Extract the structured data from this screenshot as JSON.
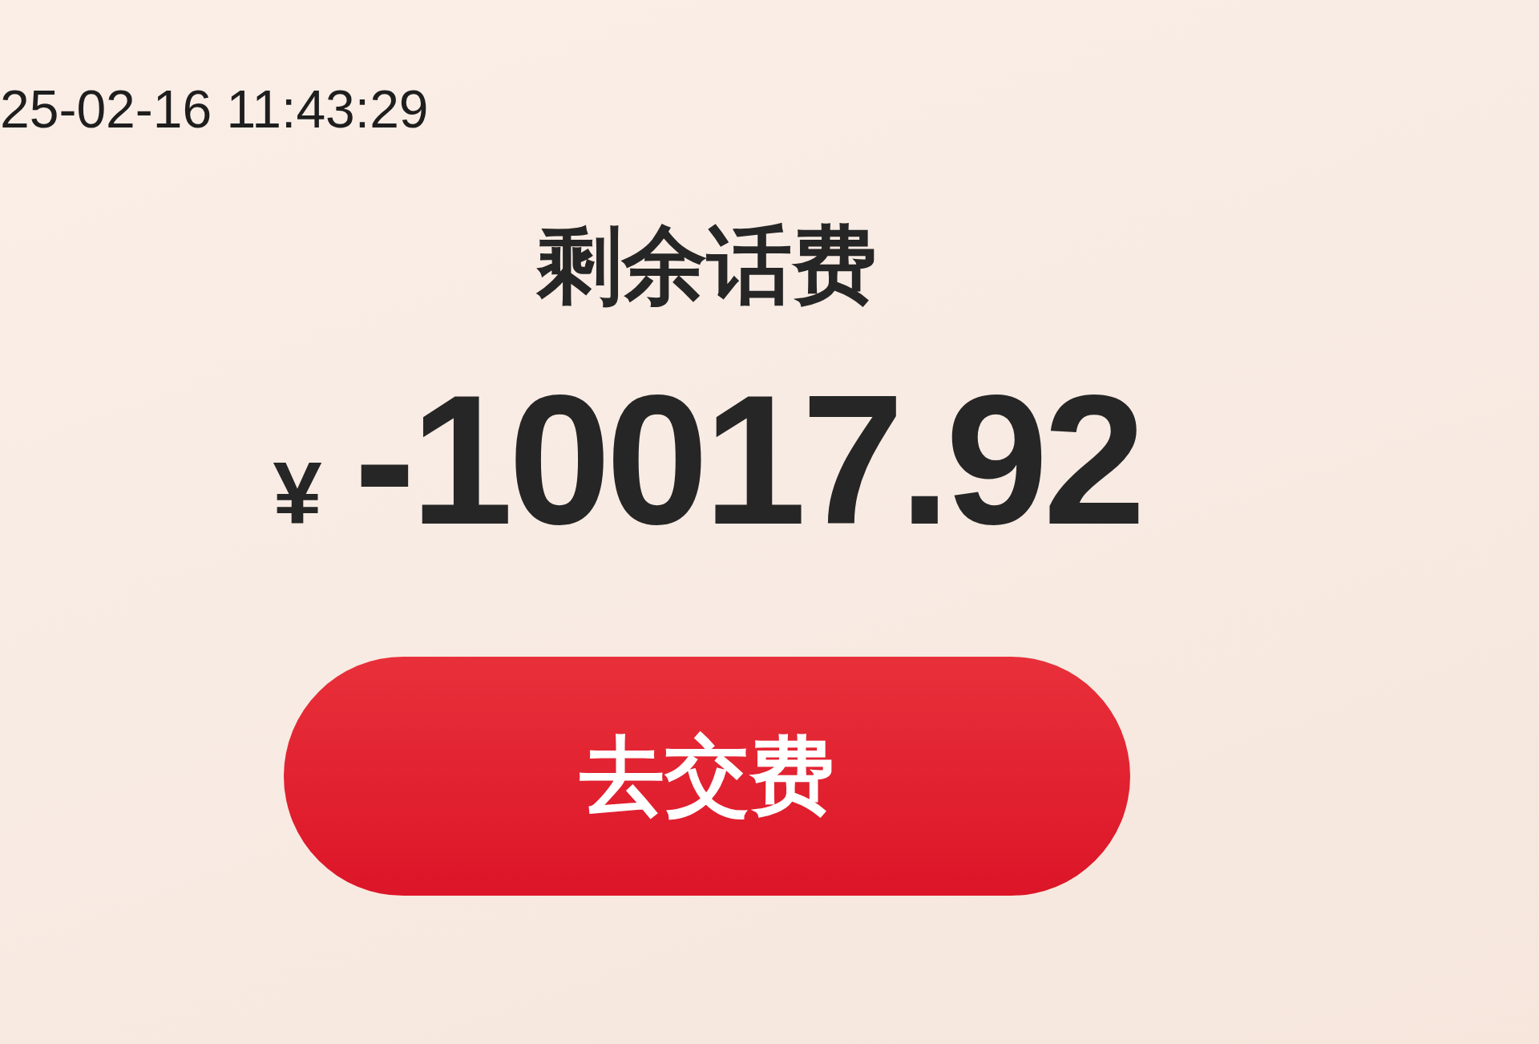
{
  "timestamp": "25-02-16 11:43:29",
  "balance": {
    "label": "剩余话费",
    "currency": "¥",
    "amount": "-10017.92"
  },
  "pay_button": {
    "label": "去交费"
  }
}
